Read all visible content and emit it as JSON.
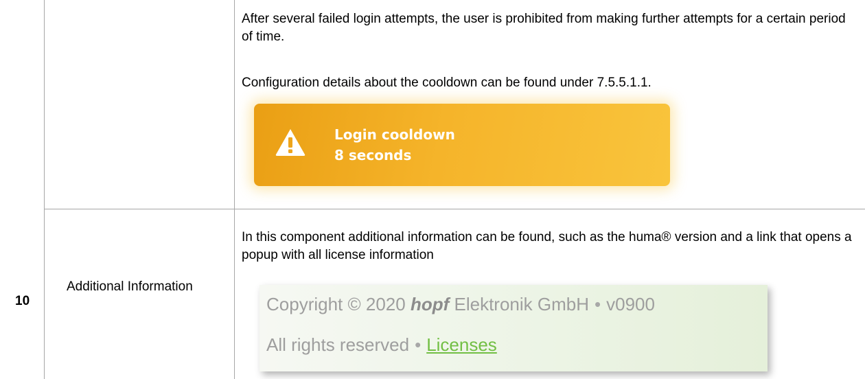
{
  "rows": [
    {
      "number": "",
      "label": "",
      "paragraphs": [
        "After several failed login attempts, the user is prohibited from making further attempts for a certain period of time.",
        "Configuration details about the cooldown can be found under 7.5.5.1.1."
      ],
      "alert": {
        "icon": "warning-icon",
        "title": "Login cooldown",
        "subtitle": "8 seconds",
        "color": "#f5b42a"
      }
    },
    {
      "number": "10",
      "label": "Additional Information",
      "paragraphs": [
        "In this component additional information can be found, such as the huma® version and a link that opens a popup with all license information"
      ],
      "footer": {
        "copyright_prefix": "Copyright © 2020",
        "brand": "hopf",
        "company": "Elektronik GmbH",
        "separator": "•",
        "version": "v0900",
        "rights": "All rights reserved",
        "licenses_link": "Licenses",
        "link_color": "#72bf44"
      }
    }
  ]
}
